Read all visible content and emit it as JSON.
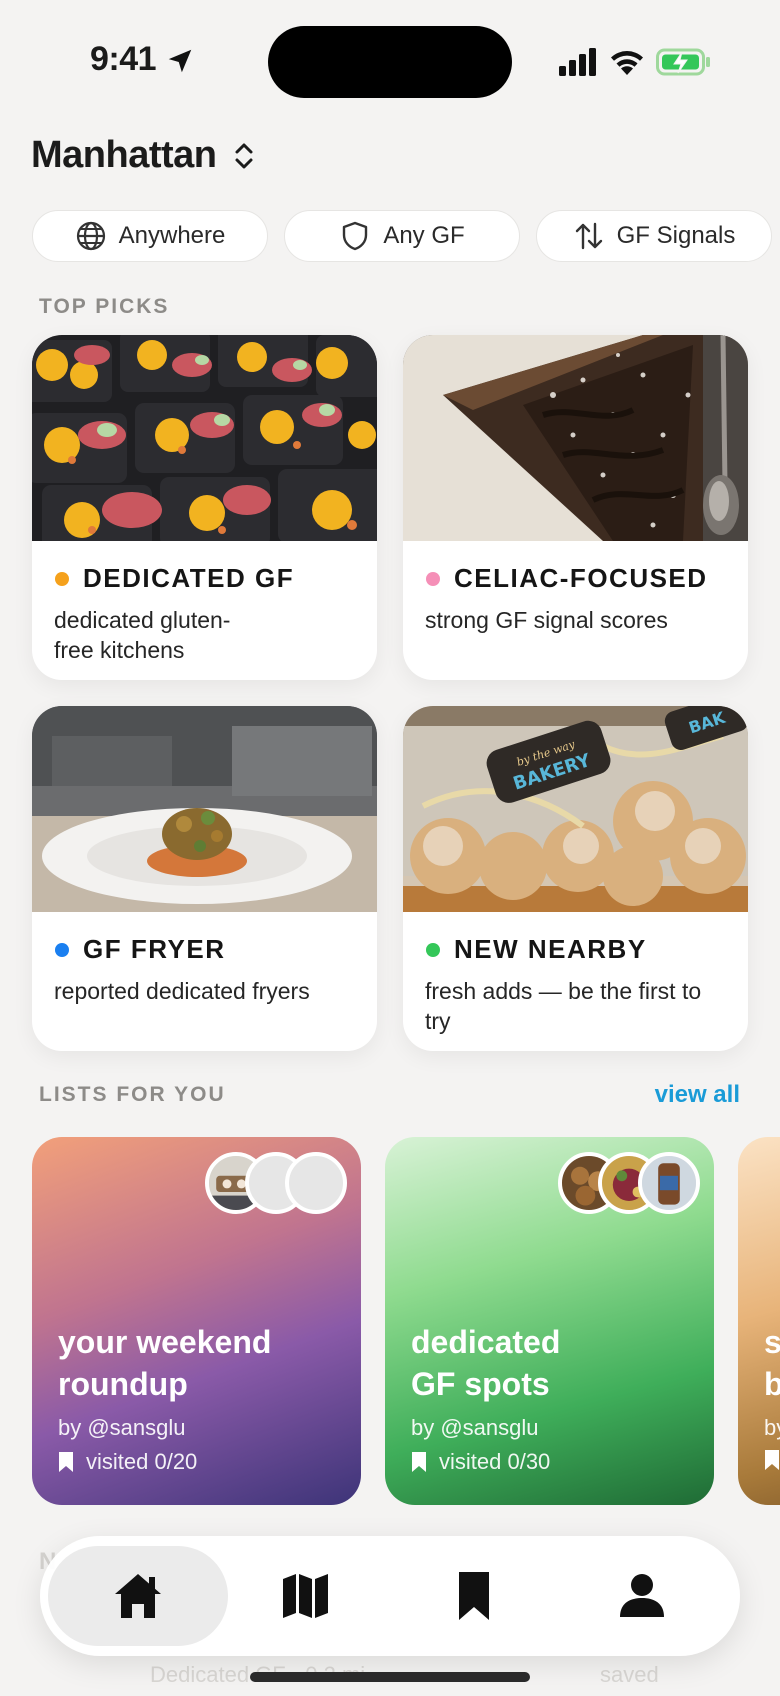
{
  "status_bar": {
    "time": "9:41"
  },
  "header": {
    "location": "Manhattan"
  },
  "filters": [
    {
      "label": "Anywhere",
      "icon": "globe-icon"
    },
    {
      "label": "Any GF",
      "icon": "shield-icon"
    },
    {
      "label": "GF Signals",
      "icon": "sort-arrows-icon"
    }
  ],
  "top_picks": {
    "heading": "TOP PICKS",
    "cards": [
      {
        "title": "DEDICATED GF",
        "description": "dedicated gluten-free kitchens",
        "dot_color": "#f5a11c",
        "photo": "meal-prep-trays"
      },
      {
        "title": "CELIAC-FOCUSED",
        "description": "strong GF signal scores",
        "dot_color": "#f58fb7",
        "photo": "chocolate-tart-slice"
      },
      {
        "title": "GF FRYER",
        "description": "reported dedicated fryers",
        "dot_color": "#1a7ff0",
        "photo": "plated-dish-kitchen"
      },
      {
        "title": "NEW NEARBY",
        "description": "fresh adds — be the first to try",
        "dot_color": "#34c759",
        "photo": "bakery-bags"
      }
    ]
  },
  "lists": {
    "heading": "LISTS FOR YOU",
    "view_all": "view all",
    "cards": [
      {
        "title": "your weekend roundup",
        "author": "by @sansglu",
        "visited": "visited 0/20"
      },
      {
        "title": "dedicated GF spots",
        "author": "by @sansglu",
        "visited": "visited 0/30"
      },
      {
        "title": "s b",
        "author": "by",
        "visited": ""
      }
    ]
  },
  "faded_section": {
    "label": "N",
    "item": "Dedicated GF · 0.2 mi",
    "saved": "saved"
  },
  "tabs": [
    {
      "name": "home",
      "active": true
    },
    {
      "name": "map",
      "active": false
    },
    {
      "name": "saved",
      "active": false
    },
    {
      "name": "profile",
      "active": false
    }
  ],
  "colors": {
    "background": "#f4f3f2",
    "accent_link": "#1a9bd7",
    "dedicated_dot": "#f5a11c",
    "celiac_dot": "#f58fb7",
    "fryer_dot": "#1a7ff0",
    "new_dot": "#34c759"
  }
}
